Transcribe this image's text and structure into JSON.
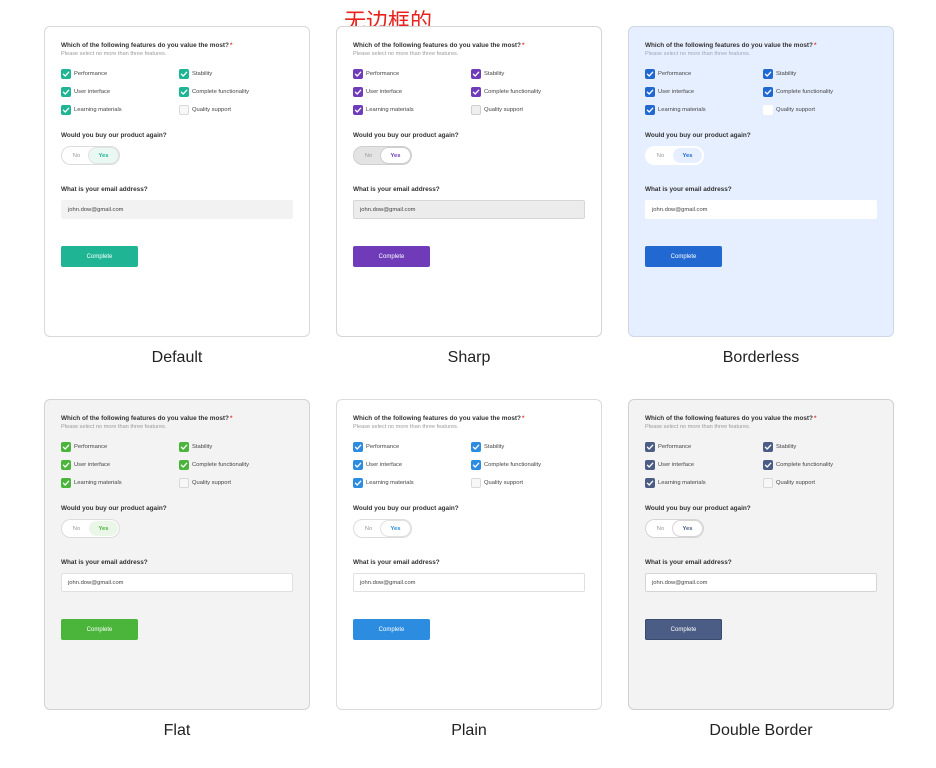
{
  "annotation": "无边框的",
  "survey": {
    "question_features": "Which of the following features do you value the most?",
    "required_mark": "*",
    "hint": "Please select no more than three features.",
    "features": [
      {
        "label": "Performance",
        "checked": true
      },
      {
        "label": "Stability",
        "checked": true
      },
      {
        "label": "User interface",
        "checked": true
      },
      {
        "label": "Complete functionality",
        "checked": true
      },
      {
        "label": "Learning materials",
        "checked": true
      },
      {
        "label": "Quality support",
        "checked": false
      }
    ],
    "question_buy_again": "Would you buy our product again?",
    "option_no": "No",
    "option_yes": "Yes",
    "selected_option": "Yes",
    "question_email": "What is your email address?",
    "email_value": "john.dow@gmail.com",
    "submit_label": "Complete"
  },
  "variants": [
    {
      "caption": "Default",
      "accent": "#1fb594"
    },
    {
      "caption": "Sharp",
      "accent": "#6f3bb8"
    },
    {
      "caption": "Borderless",
      "accent": "#2169d1"
    },
    {
      "caption": "Flat",
      "accent": "#4ab53a"
    },
    {
      "caption": "Plain",
      "accent": "#2c8ce0"
    },
    {
      "caption": "Double Border",
      "accent": "#4b5d84"
    }
  ]
}
